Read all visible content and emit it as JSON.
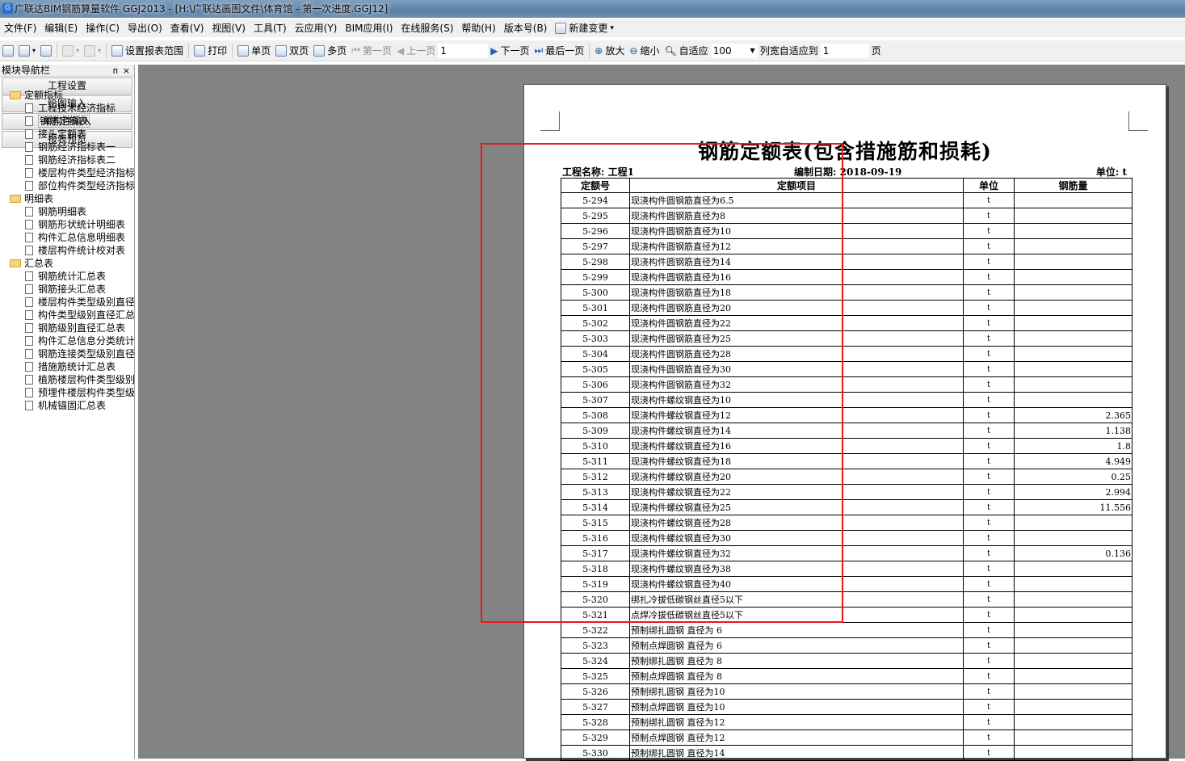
{
  "window": {
    "title": "广联达BIM钢筋算量软件 GGJ2013 - [H:\\广联达画图文件\\体育馆 - 第一次进度.GGJ12]"
  },
  "menu": [
    "文件(F)",
    "编辑(E)",
    "操作(C)",
    "导出(O)",
    "查看(V)",
    "视图(V)",
    "工具(T)",
    "云应用(Y)",
    "BIM应用(I)",
    "在线服务(S)",
    "帮助(H)",
    "版本号(B)",
    "新建变更"
  ],
  "toolbar": {
    "set_range": "设置报表范围",
    "print": "打印",
    "single_page": "单页",
    "double_page": "双页",
    "multi_page": "多页",
    "first_page": "第一页",
    "prev_page": "上一页",
    "page_value": "1",
    "next_page": "下一页",
    "last_page": "最后一页",
    "zoom_in": "放大",
    "zoom_out": "缩小",
    "fit": "自适应",
    "zoom_value": "100",
    "col_fit": "列宽自适应到",
    "col_fit_value": "1",
    "page_unit": "页"
  },
  "nav": {
    "title": "模块导航栏",
    "pin": "ᴨ",
    "close": "×",
    "buttons": [
      "工程设置",
      "绘图输入",
      "单构件输入",
      "报表预览"
    ]
  },
  "tree": [
    {
      "type": "folder",
      "label": "定额指标"
    },
    {
      "type": "doc",
      "label": "工程技术经济指标"
    },
    {
      "type": "doc",
      "label": "钢筋定额表",
      "selected": true
    },
    {
      "type": "doc",
      "label": "接头定额表"
    },
    {
      "type": "doc",
      "label": "钢筋经济指标表一"
    },
    {
      "type": "doc",
      "label": "钢筋经济指标表二"
    },
    {
      "type": "doc",
      "label": "楼层构件类型经济指标"
    },
    {
      "type": "doc",
      "label": "部位构件类型经济指标"
    },
    {
      "type": "folder",
      "label": "明细表"
    },
    {
      "type": "doc",
      "label": "钢筋明细表"
    },
    {
      "type": "doc",
      "label": "钢筋形状统计明细表"
    },
    {
      "type": "doc",
      "label": "构件汇总信息明细表"
    },
    {
      "type": "doc",
      "label": "楼层构件统计校对表"
    },
    {
      "type": "folder",
      "label": "汇总表"
    },
    {
      "type": "doc",
      "label": "钢筋统计汇总表"
    },
    {
      "type": "doc",
      "label": "钢筋接头汇总表"
    },
    {
      "type": "doc",
      "label": "楼层构件类型级别直径"
    },
    {
      "type": "doc",
      "label": "构件类型级别直径汇总"
    },
    {
      "type": "doc",
      "label": "钢筋级别直径汇总表"
    },
    {
      "type": "doc",
      "label": "构件汇总信息分类统计"
    },
    {
      "type": "doc",
      "label": "钢筋连接类型级别直径"
    },
    {
      "type": "doc",
      "label": "措施筋统计汇总表"
    },
    {
      "type": "doc",
      "label": "植筋楼层构件类型级别"
    },
    {
      "type": "doc",
      "label": "预埋件楼层构件类型级"
    },
    {
      "type": "doc",
      "label": "机械锚固汇总表"
    }
  ],
  "report": {
    "title": "钢筋定额表(包含措施筋和损耗)",
    "project_label": "工程名称: 工程1",
    "date_label": "编制日期: 2018-09-19",
    "unit_label": "单位: t",
    "headers": [
      "定额号",
      "定额项目",
      "单位",
      "钢筋量"
    ],
    "rows": [
      [
        "5-294",
        "现浇构件圆钢筋直径为6.5",
        "t",
        ""
      ],
      [
        "5-295",
        "现浇构件圆钢筋直径为8",
        "t",
        ""
      ],
      [
        "5-296",
        "现浇构件圆钢筋直径为10",
        "t",
        ""
      ],
      [
        "5-297",
        "现浇构件圆钢筋直径为12",
        "t",
        ""
      ],
      [
        "5-298",
        "现浇构件圆钢筋直径为14",
        "t",
        ""
      ],
      [
        "5-299",
        "现浇构件圆钢筋直径为16",
        "t",
        ""
      ],
      [
        "5-300",
        "现浇构件圆钢筋直径为18",
        "t",
        ""
      ],
      [
        "5-301",
        "现浇构件圆钢筋直径为20",
        "t",
        ""
      ],
      [
        "5-302",
        "现浇构件圆钢筋直径为22",
        "t",
        ""
      ],
      [
        "5-303",
        "现浇构件圆钢筋直径为25",
        "t",
        ""
      ],
      [
        "5-304",
        "现浇构件圆钢筋直径为28",
        "t",
        ""
      ],
      [
        "5-305",
        "现浇构件圆钢筋直径为30",
        "t",
        ""
      ],
      [
        "5-306",
        "现浇构件圆钢筋直径为32",
        "t",
        ""
      ],
      [
        "5-307",
        "现浇构件螺纹钢直径为10",
        "t",
        ""
      ],
      [
        "5-308",
        "现浇构件螺纹钢直径为12",
        "t",
        "2.365"
      ],
      [
        "5-309",
        "现浇构件螺纹钢直径为14",
        "t",
        "1.138"
      ],
      [
        "5-310",
        "现浇构件螺纹钢直径为16",
        "t",
        "1.8"
      ],
      [
        "5-311",
        "现浇构件螺纹钢直径为18",
        "t",
        "4.949"
      ],
      [
        "5-312",
        "现浇构件螺纹钢直径为20",
        "t",
        "0.25"
      ],
      [
        "5-313",
        "现浇构件螺纹钢直径为22",
        "t",
        "2.994"
      ],
      [
        "5-314",
        "现浇构件螺纹钢直径为25",
        "t",
        "11.556"
      ],
      [
        "5-315",
        "现浇构件螺纹钢直径为28",
        "t",
        ""
      ],
      [
        "5-316",
        "现浇构件螺纹钢直径为30",
        "t",
        ""
      ],
      [
        "5-317",
        "现浇构件螺纹钢直径为32",
        "t",
        "0.136"
      ],
      [
        "5-318",
        "现浇构件螺纹钢直径为38",
        "t",
        ""
      ],
      [
        "5-319",
        "现浇构件螺纹钢直径为40",
        "t",
        ""
      ],
      [
        "5-320",
        "绑扎冷拔低碳钢丝直径5以下",
        "t",
        ""
      ],
      [
        "5-321",
        "点焊冷拔低碳钢丝直径5以下",
        "t",
        ""
      ],
      [
        "5-322",
        "预制绑扎圆钢 直径为 6",
        "t",
        ""
      ],
      [
        "5-323",
        "预制点焊圆钢 直径为 6",
        "t",
        ""
      ],
      [
        "5-324",
        "预制绑扎圆钢 直径为 8",
        "t",
        ""
      ],
      [
        "5-325",
        "预制点焊圆钢 直径为 8",
        "t",
        ""
      ],
      [
        "5-326",
        "预制绑扎圆钢 直径为10",
        "t",
        ""
      ],
      [
        "5-327",
        "预制点焊圆钢 直径为10",
        "t",
        ""
      ],
      [
        "5-328",
        "预制绑扎圆钢 直径为12",
        "t",
        ""
      ],
      [
        "5-329",
        "预制点焊圆钢 直径为12",
        "t",
        ""
      ],
      [
        "5-330",
        "预制绑扎圆钢 直径为14",
        "t",
        ""
      ]
    ]
  },
  "colors": {
    "highlight_box": "#e8191f",
    "workspace_bg": "#838383"
  }
}
